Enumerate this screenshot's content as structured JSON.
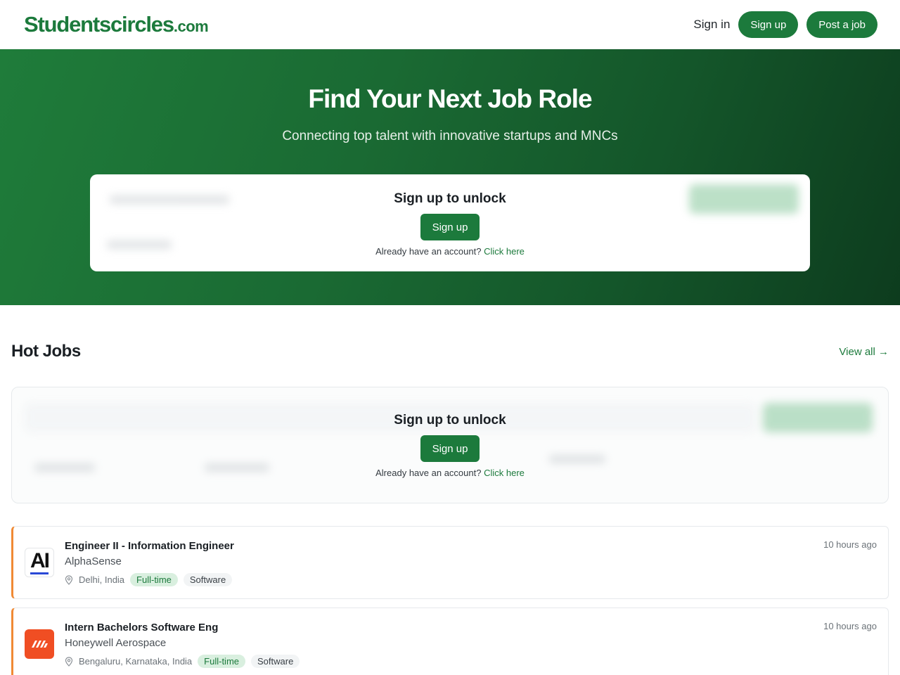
{
  "header": {
    "logo_main": "Studentscircles",
    "logo_tld": ".com",
    "signin_label": "Sign in",
    "signup_label": "Sign up",
    "post_job_label": "Post a job"
  },
  "hero": {
    "title": "Find Your Next Job Role",
    "subtitle": "Connecting top talent with innovative startups and MNCs"
  },
  "lock_panel": {
    "title": "Sign up to unlock",
    "button_label": "Sign up",
    "account_prompt": "Already have an account?",
    "login_link": "Click here"
  },
  "hot_jobs": {
    "title": "Hot Jobs",
    "view_all_label": "View all →",
    "jobs": [
      {
        "title": "Engineer II - Information Engineer",
        "company": "AlphaSense",
        "location": "Delhi, India",
        "type": "Full-time",
        "category": "Software",
        "posted": "10 hours ago",
        "logo_text": "AI"
      },
      {
        "title": "Intern Bachelors Software Eng",
        "company": "Honeywell Aerospace",
        "location": "Bengaluru, Karnataka, India",
        "type": "Full-time",
        "category": "Software",
        "posted": "10 hours ago",
        "logo_text": ""
      }
    ]
  },
  "colors": {
    "brand": "#1c7a3c",
    "accent_border": "#f08a35",
    "honeywell": "#f04e23"
  },
  "icons": [
    "location-pin-icon",
    "honeywell-logo-icon",
    "alphasense-logo-icon",
    "arrow-right-icon"
  ]
}
